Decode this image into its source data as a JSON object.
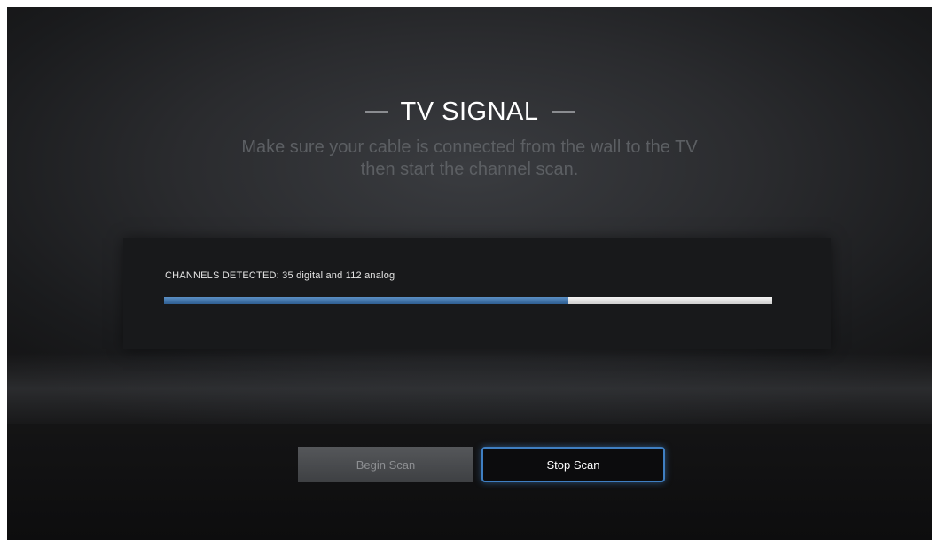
{
  "screen": {
    "title": "TV SIGNAL",
    "subtitle_line1": "Make sure your cable is connected from the wall to the TV",
    "subtitle_line2": "then start the channel scan."
  },
  "scan": {
    "channels_label": "CHANNELS DETECTED:",
    "digital_count": "35",
    "digital_label": "digital and",
    "analog_count": "112",
    "analog_label": "analog",
    "progress_fraction": 0.665
  },
  "buttons": {
    "begin_label": "Begin Scan",
    "begin_enabled": false,
    "stop_label": "Stop Scan",
    "stop_focused": true
  },
  "colors": {
    "accent_blue": "#3f7fc2",
    "progress_fill": "#4a7db3",
    "background": "#2a2b2e"
  }
}
